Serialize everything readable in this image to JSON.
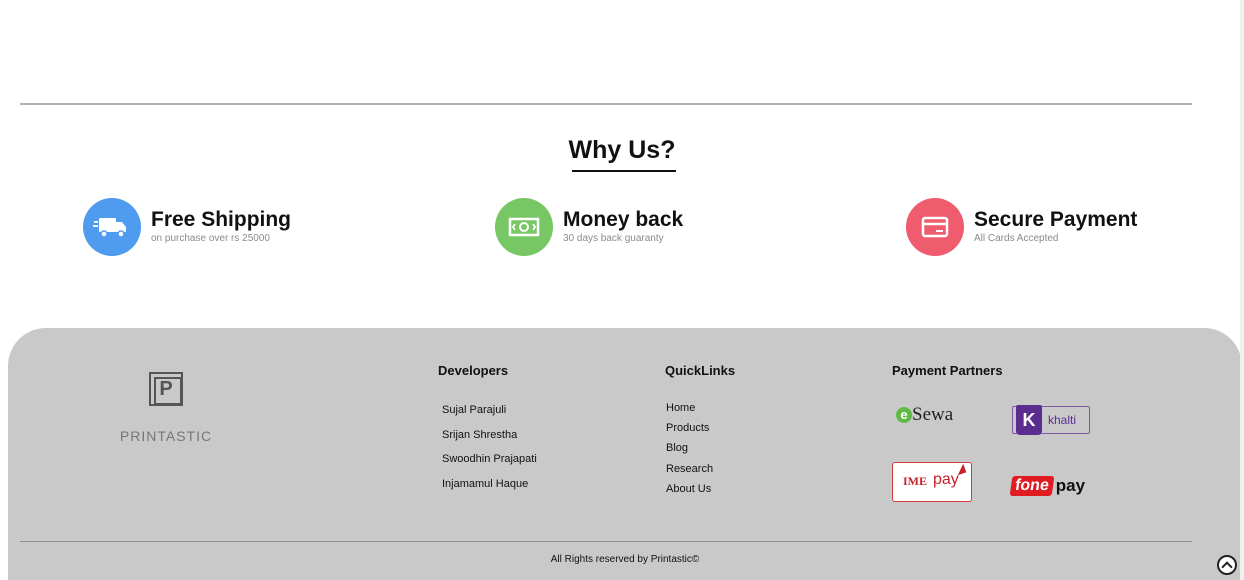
{
  "why_us": {
    "title": "Why Us?",
    "features": [
      {
        "title": "Free Shipping",
        "subtitle": "on purchase over rs 25000",
        "icon": "delivery-truck-icon",
        "color": "#4e9bf0"
      },
      {
        "title": "Money back",
        "subtitle": "30 days back guaranty",
        "icon": "cash-icon",
        "color": "#78c765"
      },
      {
        "title": "Secure Payment",
        "subtitle": "All Cards Accepted",
        "icon": "card-icon",
        "color": "#ee5c6e"
      }
    ]
  },
  "footer": {
    "brand": "PRINTASTIC",
    "developers": {
      "heading": "Developers",
      "items": [
        "Sujal Parajuli",
        "Srijan Shrestha",
        "Swoodhin Prajapati",
        "Injamamul Haque"
      ]
    },
    "quicklinks": {
      "heading": "QuickLinks",
      "items": [
        "Home",
        "Products",
        "Blog",
        "Research",
        "About Us"
      ]
    },
    "payment_partners": {
      "heading": "Payment Partners",
      "esewa": "Sewa",
      "khalti": "khalti",
      "ime_a": "IME",
      "ime_b": "pay",
      "fonepay_a": "fone",
      "fonepay_b": "pay"
    },
    "copyright": "All Rights reserved by Printastic©"
  },
  "colors": {
    "footer_bg": "#c9c9c9"
  }
}
